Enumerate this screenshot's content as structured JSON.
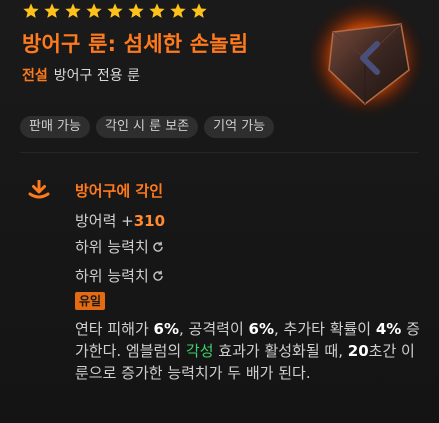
{
  "item": {
    "star_count": 9,
    "star_color": "#ffc21a",
    "title": "방어구 룬: 섬세한 손놀림",
    "grade": "전설",
    "type": "방어구 전용 룬",
    "icon": "rune-gem-icon",
    "accent_color": "#ff7a1c"
  },
  "tags": [
    "판매 가능",
    "각인 시 룬 보존",
    "기억 가능"
  ],
  "engrave": {
    "icon": "download-arrow-icon",
    "title": "방어구에 각인",
    "defense_label": "방어력 +",
    "defense_value": "310",
    "sub_stat_1": "하위 능력치",
    "sub_stat_2": "하위 능력치",
    "refresh_icon": "refresh-icon",
    "unique_badge": "유일",
    "desc": {
      "p1": "연타 피해가 ",
      "v1": "6%",
      "p2": ", 공격력이 ",
      "v2": "6%",
      "p3": ", 추가타 확률이 ",
      "v3": "4%",
      "p4": " 증가한다. 엠블럼의 ",
      "g1": "각성",
      "p5": " 효과가 활성화될 때, ",
      "v4": "20",
      "p6": "초간 이 룬으로 증가한 능력치가 두 배가 된다."
    }
  }
}
